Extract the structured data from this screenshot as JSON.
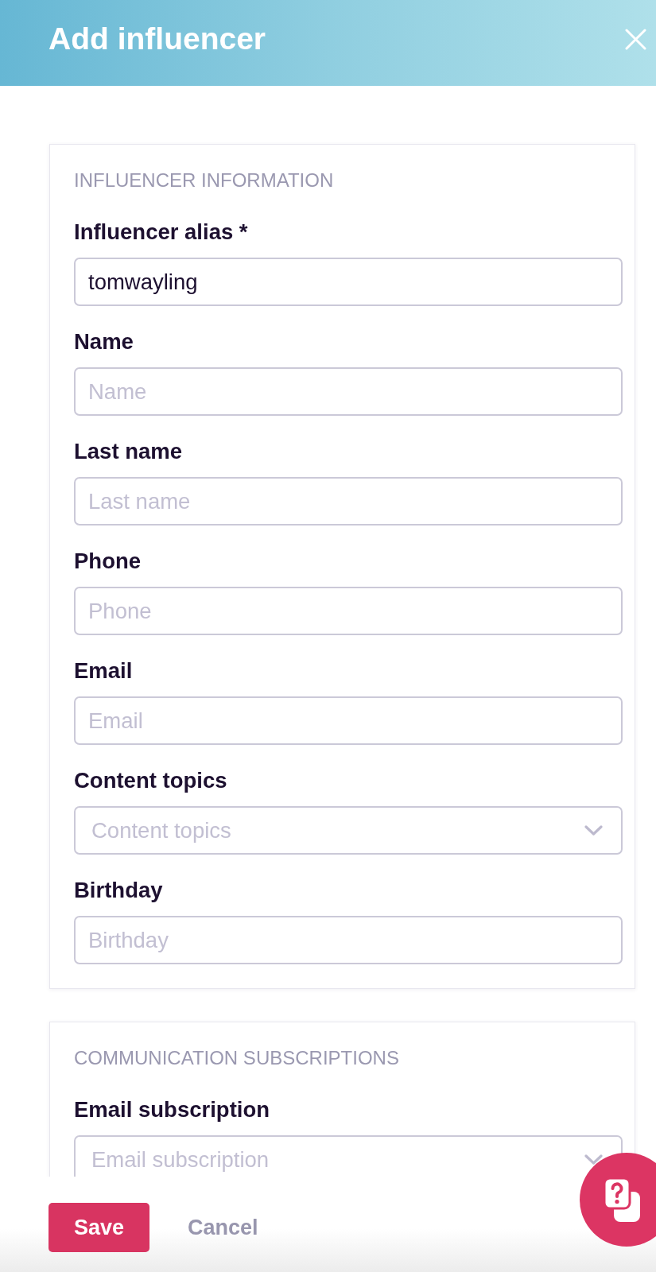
{
  "header": {
    "title": "Add influencer"
  },
  "sections": [
    {
      "heading": "INFLUENCER INFORMATION",
      "fields": [
        {
          "kind": "text",
          "label": "Influencer alias *",
          "value": "tomwayling"
        },
        {
          "kind": "text",
          "label": "Name",
          "placeholder": "Name"
        },
        {
          "kind": "text",
          "label": "Last name",
          "placeholder": "Last name"
        },
        {
          "kind": "text",
          "label": "Phone",
          "placeholder": "Phone"
        },
        {
          "kind": "text",
          "label": "Email",
          "placeholder": "Email"
        },
        {
          "kind": "select",
          "label": "Content topics",
          "placeholder": "Content topics"
        },
        {
          "kind": "text",
          "label": "Birthday",
          "placeholder": "Birthday"
        }
      ]
    },
    {
      "heading": "COMMUNICATION SUBSCRIPTIONS",
      "fields": [
        {
          "kind": "select",
          "label": "Email subscription",
          "placeholder": "Email subscription"
        }
      ]
    }
  ],
  "footer": {
    "buttons": [
      {
        "kind": "primary",
        "label": "Save"
      },
      {
        "kind": "link",
        "label": "Cancel"
      }
    ]
  }
}
